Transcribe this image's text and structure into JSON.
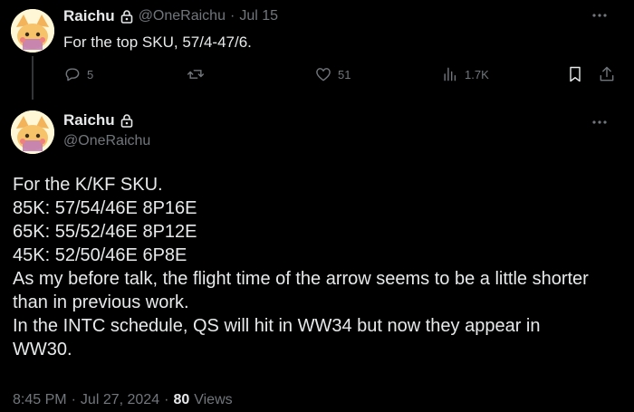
{
  "reply_tweet": {
    "author_name": "Raichu",
    "handle": "@OneRaichu",
    "separator": "·",
    "date": "Jul 15",
    "text": "For the top SKU, 57/4-47/6.",
    "actions": {
      "replies": "5",
      "likes": "51",
      "views": "1.7K"
    }
  },
  "main_tweet": {
    "author_name": "Raichu",
    "handle": "@OneRaichu",
    "lines": [
      "For the K/KF SKU.",
      "85K: 57/54/46E 8P16E",
      "65K: 55/52/46E 8P12E",
      "45K: 52/50/46E 6P8E",
      "As my before talk, the flight time of the arrow seems to be a little shorter",
      "than in previous work.",
      "In the INTC schedule, QS will hit in WW34 but now they appear in",
      "WW30."
    ],
    "time": "8:45 PM",
    "separator": "·",
    "date": "Jul 27, 2024",
    "separator2": "·",
    "views_count": "80",
    "views_label": "Views"
  },
  "icons": {
    "more": "more-icon",
    "lock": "lock-icon",
    "reply": "reply-icon",
    "retweet": "retweet-icon",
    "like": "heart-icon",
    "views": "analytics-icon",
    "bookmark": "bookmark-icon",
    "share": "share-icon"
  },
  "colors": {
    "background": "#000000",
    "text": "#e7e9ea",
    "muted": "#71767b"
  }
}
